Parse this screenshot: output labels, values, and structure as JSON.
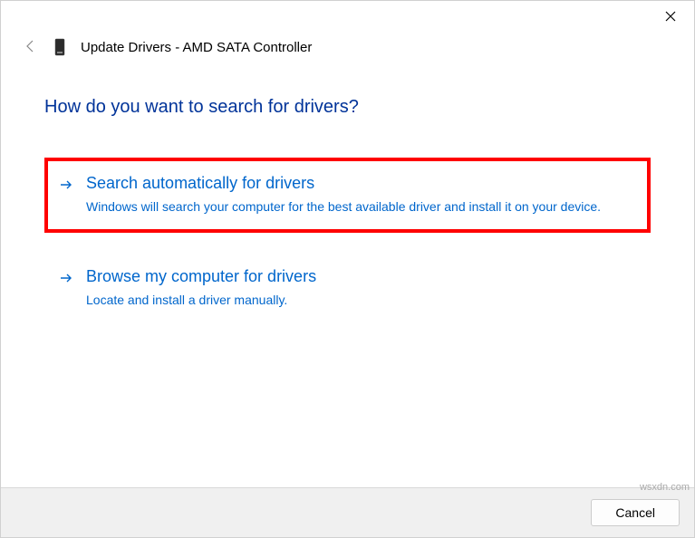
{
  "header": {
    "title": "Update Drivers - AMD SATA Controller"
  },
  "question": "How do you want to search for drivers?",
  "options": [
    {
      "title": "Search automatically for drivers",
      "description": "Windows will search your computer for the best available driver and install it on your device."
    },
    {
      "title": "Browse my computer for drivers",
      "description": "Locate and install a driver manually."
    }
  ],
  "footer": {
    "cancel_label": "Cancel"
  },
  "watermark": "wsxdn.com"
}
